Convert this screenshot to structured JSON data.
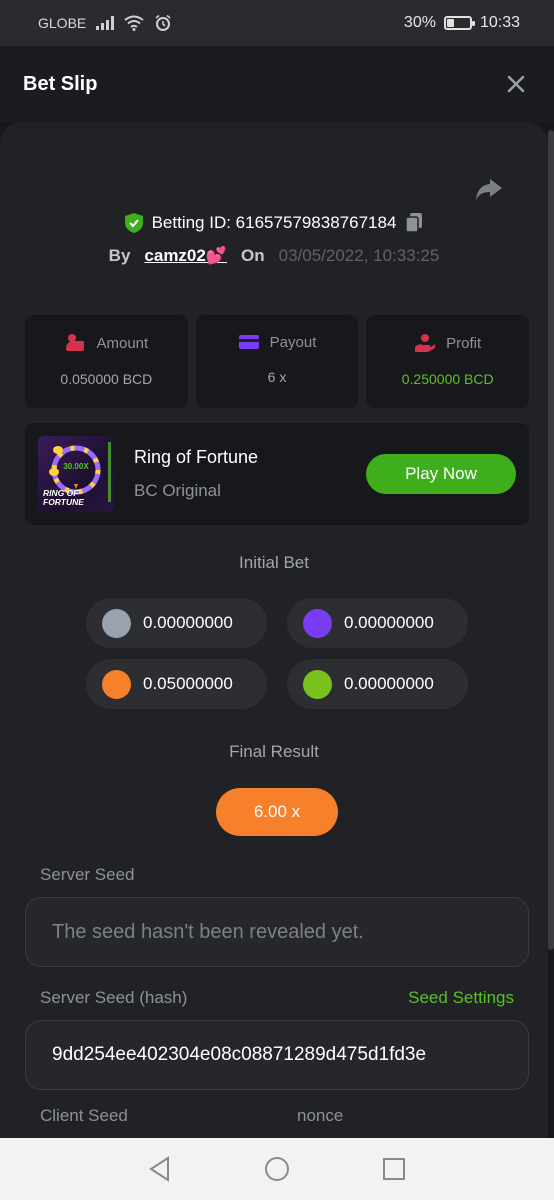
{
  "status": {
    "carrier": "GLOBE",
    "battery": "30%",
    "battery_level": 0.3,
    "time": "10:33"
  },
  "header": {
    "title": "Bet Slip"
  },
  "bet": {
    "betting_id_label": "Betting ID: 61657579838767184",
    "by_label": "By",
    "user": "camz02💕",
    "on_label": "On",
    "date": "03/05/2022, 10:33:25"
  },
  "stats": {
    "amount": {
      "label": "Amount",
      "value": "0.050000 BCD"
    },
    "payout": {
      "label": "Payout",
      "value": "6 x"
    },
    "profit": {
      "label": "Profit",
      "value": "0.250000 BCD"
    }
  },
  "game": {
    "title": "Ring of Fortune",
    "subtitle": "BC Original",
    "thumb_multiplier": "30.00X",
    "thumb_line1": "RING OF",
    "thumb_line2": "FORTUNE",
    "play_label": "Play Now"
  },
  "initial_bet": {
    "title": "Initial Bet",
    "coins": [
      {
        "value": "0.00000000",
        "color": "#9aa3ad"
      },
      {
        "value": "0.00000000",
        "color": "#7a3cf2"
      },
      {
        "value": "0.05000000",
        "color": "#f7812b"
      },
      {
        "value": "0.00000000",
        "color": "#79c11c"
      }
    ]
  },
  "final_result": {
    "title": "Final Result",
    "value": "6.00 x"
  },
  "server_seed": {
    "label": "Server Seed",
    "value": "The seed hasn't been revealed yet."
  },
  "server_seed_hash": {
    "label": "Server Seed (hash)",
    "link": "Seed Settings",
    "value": "9dd254ee402304e08c08871289d475d1fd3e"
  },
  "client_seed": {
    "label": "Client Seed"
  },
  "nonce": {
    "label": "nonce"
  },
  "colors": {
    "accent_green": "#3fae1c",
    "profit_green": "#5ac126",
    "orange": "#f7812b",
    "background": "#202225"
  }
}
